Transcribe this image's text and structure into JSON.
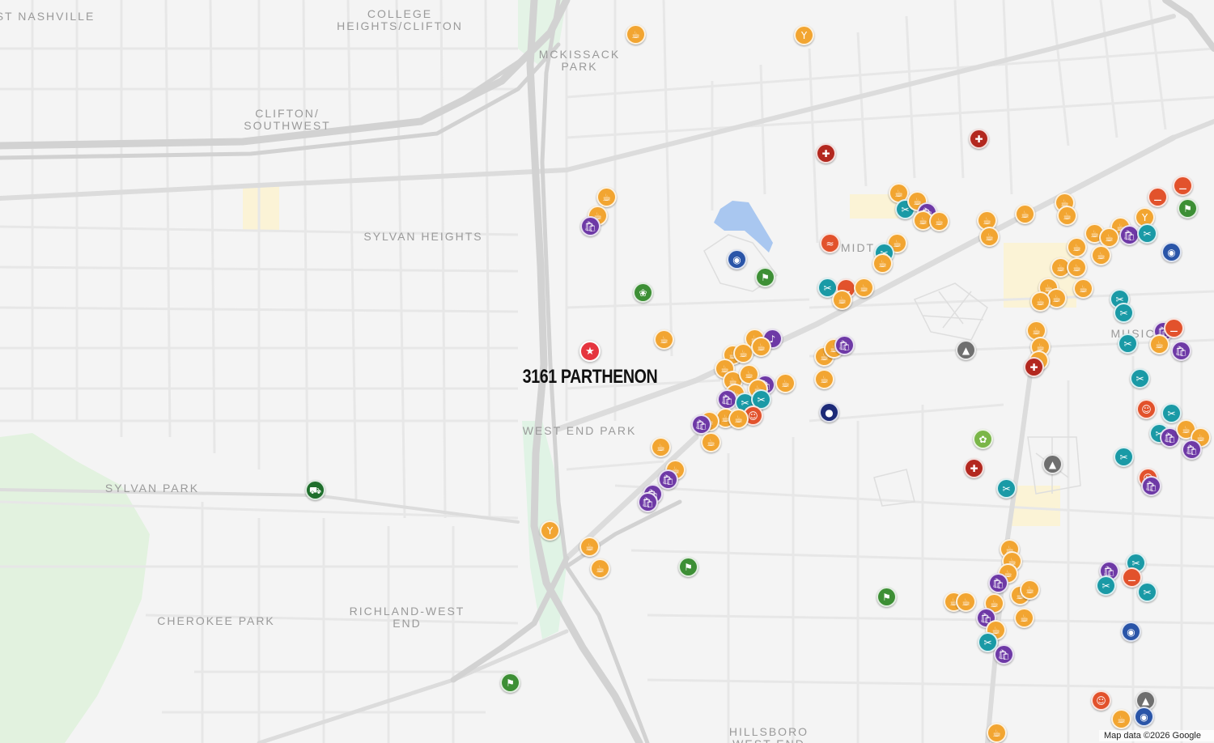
{
  "colors": {
    "food": "#f2a531",
    "shopping": "#6e39a6",
    "health": "#b3281f",
    "fitness": "#e2522c",
    "beauty": "#1a9aa6",
    "park": "#3d8f35",
    "photo": "#2a55a8",
    "education": "#6f6f6f",
    "grocery": "#1f6f2c",
    "sports": "#1c2a78",
    "garden": "#7ab648",
    "home": "#e5353f"
  },
  "icons": {
    "food": "cup-icon",
    "shopping": "shopping-bag-icon",
    "health": "medical-kit-icon",
    "fitness": "dumbbell-icon",
    "beauty": "scissors-icon",
    "park": "hiking-icon",
    "photo": "camera-icon",
    "education": "graduation-cap-icon",
    "grocery": "shopping-cart-icon",
    "sports": "football-icon",
    "garden": "flower-icon",
    "bar": "cocktail-icon",
    "pets": "paw-icon",
    "swim": "swimming-icon",
    "yoga": "yoga-icon",
    "music": "music-note-icon",
    "home": "star-icon"
  },
  "home": {
    "label": "3161 PARTHENON",
    "icon": "star-icon"
  },
  "area_labels": [
    {
      "text": "ST NASHVILLE"
    },
    {
      "text": "COLLEGE\nHEIGHTS/CLIFTON"
    },
    {
      "text": "MCKISSACK\nPARK"
    },
    {
      "text": "CLIFTON/\nSOUTHWEST"
    },
    {
      "text": "SYLVAN HEIGHTS"
    },
    {
      "text": "MIDT"
    },
    {
      "text": "MUSIC"
    },
    {
      "text": "WEST END PARK"
    },
    {
      "text": "SYLVAN PARK"
    },
    {
      "text": "RICHLAND-WEST\nEND"
    },
    {
      "text": "CHEROKEE PARK"
    },
    {
      "text": "HILLSBORO\nWEST END"
    }
  ],
  "attribution": "Map data ©2026 Google"
}
